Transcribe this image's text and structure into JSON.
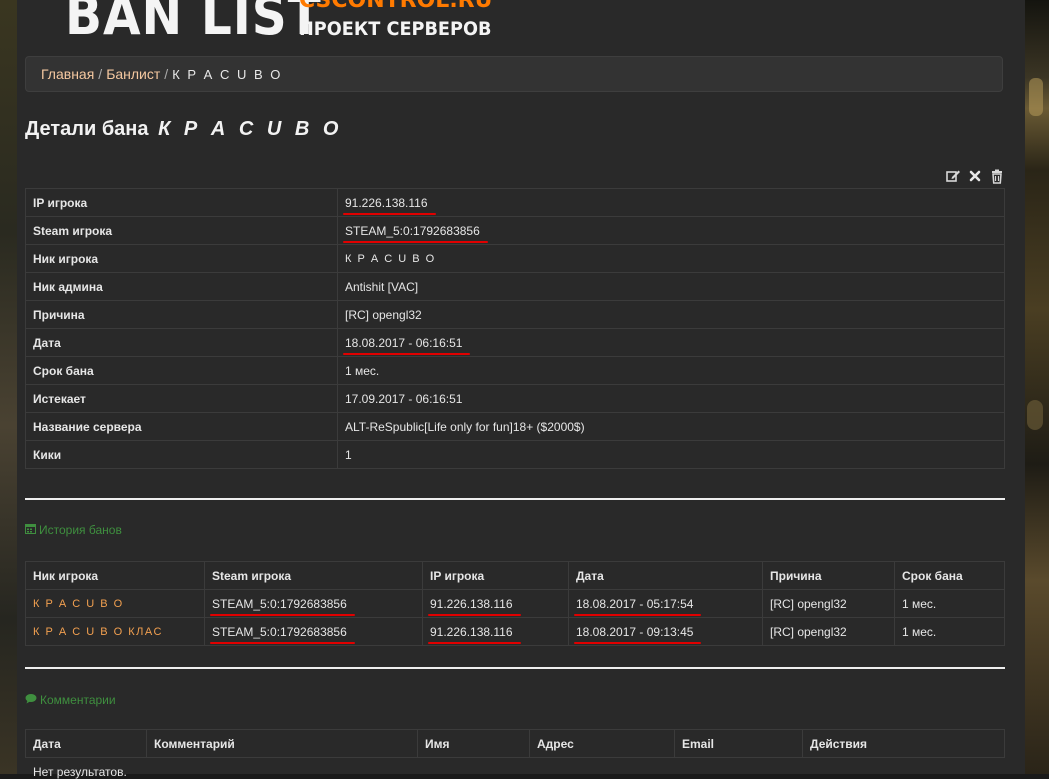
{
  "header": {
    "logo_main": "BAN LIST",
    "logo_site": "CSCONTROL.RU",
    "logo_sub": "ПРОЕКТ СЕРВЕРОВ"
  },
  "breadcrumb": {
    "home": "Главная",
    "separator": "/",
    "banlist": "Банлист",
    "current": "К Р А С U В О"
  },
  "title": {
    "prefix": "Детали бана",
    "nick": "К Р А С U В О"
  },
  "actions": [
    {
      "name": "edit-icon"
    },
    {
      "name": "close-icon"
    },
    {
      "name": "trash-icon"
    }
  ],
  "details": [
    {
      "key": "IP игрока",
      "value": "91.226.138.116"
    },
    {
      "key": "Steam игрока",
      "value": "STEAM_5:0:1792683856"
    },
    {
      "key": "Ник игрока",
      "value": "К Р А С U В О"
    },
    {
      "key": "Ник админа",
      "value": "Antishit [VAC]"
    },
    {
      "key": "Причина",
      "value": "[RC] opengl32"
    },
    {
      "key": "Дата",
      "value": "18.08.2017 - 06:16:51"
    },
    {
      "key": "Срок бана",
      "value": "1 мес."
    },
    {
      "key": "Истекает",
      "value": "17.09.2017 - 06:16:51"
    },
    {
      "key": "Название сервера",
      "value": "ALT-ReSpublic[Life only for fun]18+ ($2000$)"
    },
    {
      "key": "Кики",
      "value": "1"
    }
  ],
  "history": {
    "title": "История банов",
    "headers": [
      "Ник игрока",
      "Steam игрока",
      "IP игрока",
      "Дата",
      "Причина",
      "Срок бана"
    ],
    "rows": [
      [
        "К Р А С U В О",
        "STEAM_5:0:1792683856",
        "91.226.138.116",
        "18.08.2017 - 05:17:54",
        "[RC] opengl32",
        "1 мес."
      ],
      [
        "К Р А С U В О КЛАС",
        "STEAM_5:0:1792683856",
        "91.226.138.116",
        "18.08.2017 - 09:13:45",
        "[RC] opengl32",
        "1 мес."
      ]
    ]
  },
  "comments": {
    "title": "Комментарии",
    "headers": [
      "Дата",
      "Комментарий",
      "Имя",
      "Адрес",
      "Email",
      "Действия"
    ],
    "empty": "Нет результатов."
  },
  "colors": {
    "link": "#f5c8a0",
    "nick_link": "#f2a050",
    "section_title": "#3f8f3f",
    "underline": "#e00000",
    "logo_accent": "#ff7a00"
  }
}
